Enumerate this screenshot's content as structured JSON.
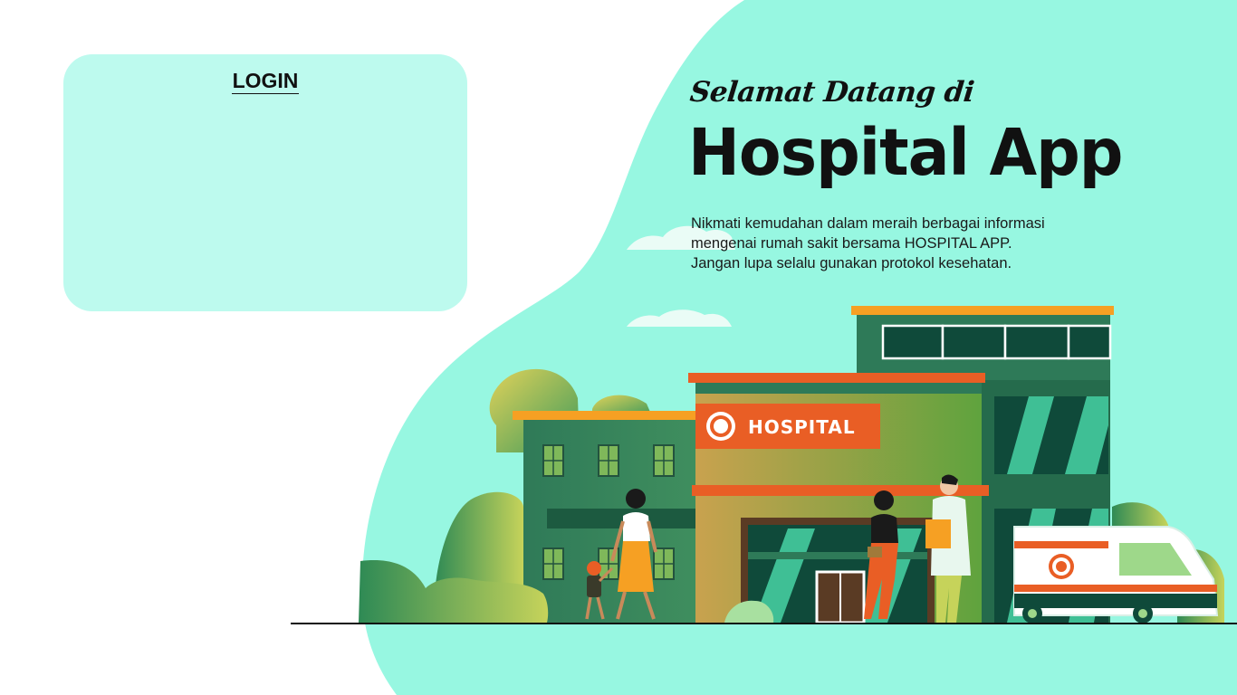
{
  "login": {
    "title": "LOGIN"
  },
  "hero": {
    "welcome": "Selamat Datang di",
    "app_name": "Hospital  App",
    "description_lines": [
      "Nikmati kemudahan dalam meraih berbagai informasi",
      "mengenai rumah sakit bersama HOSPITAL APP.",
      "Jangan lupa selalu gunakan protokol kesehatan."
    ]
  },
  "illustration": {
    "sign_text": "HOSPITAL"
  },
  "colors": {
    "blob": "#97f7e1",
    "login_card": "#bdfaee",
    "accent_orange": "#e95e25",
    "roof_orange": "#f6a023",
    "dark_green": "#2e7a58",
    "teal_glass": "#3fbf95"
  }
}
